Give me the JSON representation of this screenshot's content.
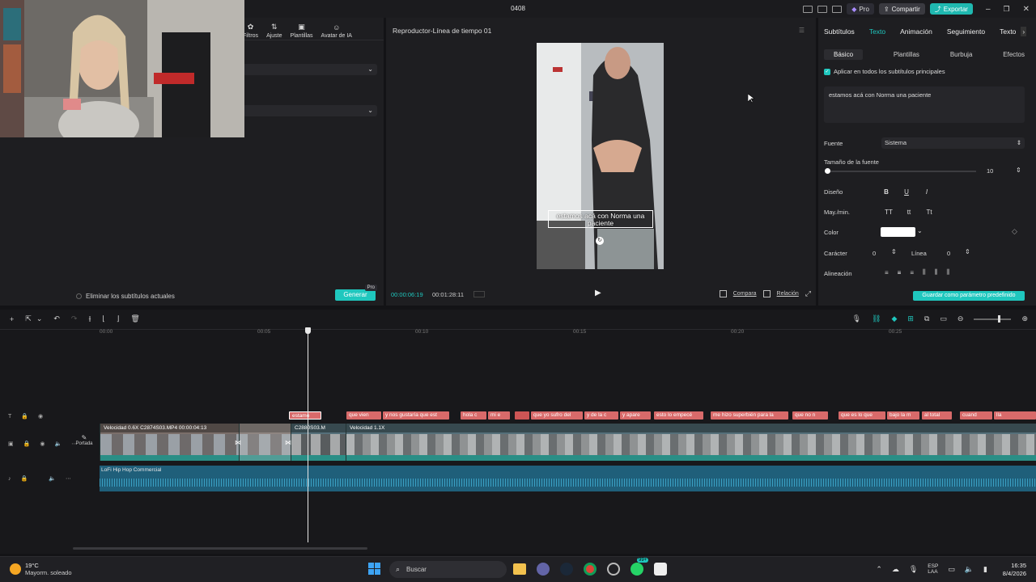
{
  "window": {
    "title": "0408",
    "pro_label": "Pro",
    "share_label": "Compartir",
    "export_label": "Exportar"
  },
  "left_panel": {
    "toolbar": [
      "Filtros",
      "Ajuste",
      "Plantillas",
      "Avatar de IA"
    ],
    "remove_subs_label": "Eliminar los subtítulos actuales",
    "generate_label": "Generar",
    "generate_badge": "Pro"
  },
  "player": {
    "title": "Reproductor-Línea de tiempo 01",
    "caption": "estamos acá con Norma una paciente",
    "current_time": "00:00:06:19",
    "total_time": "00:01:28:11",
    "compare_label": "Compara",
    "ratio_label": "Relación"
  },
  "right_panel": {
    "tabs": [
      "Subtítulos",
      "Texto",
      "Animación",
      "Seguimiento",
      "Texto"
    ],
    "active_tab": "Texto",
    "subtabs": [
      "Básico",
      "Plantillas",
      "Burbuja",
      "Efectos"
    ],
    "apply_all_label": "Aplicar en todos los subtítulos principales",
    "text_value": "estamos acá con Norma una paciente",
    "font_label": "Fuente",
    "font_value": "Sistema",
    "font_size_label": "Tamaño de la fuente",
    "font_size_value": "10",
    "design_label": "Diseño",
    "case_label": "May./min.",
    "color_label": "Color",
    "character_label": "Carácter",
    "character_value": "0",
    "line_label": "Línea",
    "line_value": "0",
    "align_label": "Alineación",
    "save_default_label": "Guardar como parámetro predefinido",
    "accent": "#1fc7be"
  },
  "timeline": {
    "ticks": [
      "00:00",
      "00:05",
      "00:10",
      "00:15",
      "00:20",
      "00:25"
    ],
    "cover_label": "Portada",
    "audio_label": "LoFi Hip Hop Commercial",
    "video_clip_1": "Velocidad 0.6X  C2874S03.MP4  00:00:04:13",
    "video_clip_2": "C2880S03.M",
    "speed_label": "Velocidad 1.1X",
    "subtitle_clips": [
      "estamo",
      "que vien",
      "y nos gustaría que est",
      "hola c",
      "mi e",
      "que yo sufro del",
      "y de la c",
      "y apare",
      "esto lo empecé",
      "me hizo superbién para la",
      "que no n",
      "que es lo que",
      "bajo la m",
      "al total",
      "cuand",
      "lla"
    ]
  },
  "taskbar": {
    "temp": "19°C",
    "weather": "Mayorm. soleado",
    "search_placeholder": "Buscar",
    "lang": "ESP",
    "lang2": "LAA",
    "time": "16:35",
    "date": "8/4/2026",
    "chat_badge": "99+"
  }
}
